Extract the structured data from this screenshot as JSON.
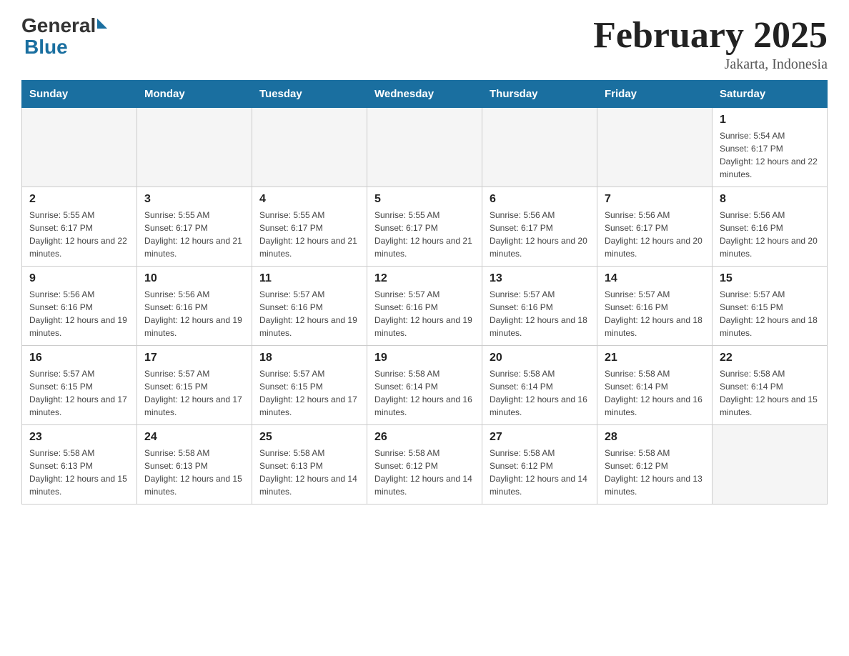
{
  "header": {
    "logo_general": "General",
    "logo_blue": "Blue",
    "month_title": "February 2025",
    "location": "Jakarta, Indonesia"
  },
  "days_of_week": [
    "Sunday",
    "Monday",
    "Tuesday",
    "Wednesday",
    "Thursday",
    "Friday",
    "Saturday"
  ],
  "weeks": [
    [
      {
        "day": "",
        "info": ""
      },
      {
        "day": "",
        "info": ""
      },
      {
        "day": "",
        "info": ""
      },
      {
        "day": "",
        "info": ""
      },
      {
        "day": "",
        "info": ""
      },
      {
        "day": "",
        "info": ""
      },
      {
        "day": "1",
        "info": "Sunrise: 5:54 AM\nSunset: 6:17 PM\nDaylight: 12 hours and 22 minutes."
      }
    ],
    [
      {
        "day": "2",
        "info": "Sunrise: 5:55 AM\nSunset: 6:17 PM\nDaylight: 12 hours and 22 minutes."
      },
      {
        "day": "3",
        "info": "Sunrise: 5:55 AM\nSunset: 6:17 PM\nDaylight: 12 hours and 21 minutes."
      },
      {
        "day": "4",
        "info": "Sunrise: 5:55 AM\nSunset: 6:17 PM\nDaylight: 12 hours and 21 minutes."
      },
      {
        "day": "5",
        "info": "Sunrise: 5:55 AM\nSunset: 6:17 PM\nDaylight: 12 hours and 21 minutes."
      },
      {
        "day": "6",
        "info": "Sunrise: 5:56 AM\nSunset: 6:17 PM\nDaylight: 12 hours and 20 minutes."
      },
      {
        "day": "7",
        "info": "Sunrise: 5:56 AM\nSunset: 6:17 PM\nDaylight: 12 hours and 20 minutes."
      },
      {
        "day": "8",
        "info": "Sunrise: 5:56 AM\nSunset: 6:16 PM\nDaylight: 12 hours and 20 minutes."
      }
    ],
    [
      {
        "day": "9",
        "info": "Sunrise: 5:56 AM\nSunset: 6:16 PM\nDaylight: 12 hours and 19 minutes."
      },
      {
        "day": "10",
        "info": "Sunrise: 5:56 AM\nSunset: 6:16 PM\nDaylight: 12 hours and 19 minutes."
      },
      {
        "day": "11",
        "info": "Sunrise: 5:57 AM\nSunset: 6:16 PM\nDaylight: 12 hours and 19 minutes."
      },
      {
        "day": "12",
        "info": "Sunrise: 5:57 AM\nSunset: 6:16 PM\nDaylight: 12 hours and 19 minutes."
      },
      {
        "day": "13",
        "info": "Sunrise: 5:57 AM\nSunset: 6:16 PM\nDaylight: 12 hours and 18 minutes."
      },
      {
        "day": "14",
        "info": "Sunrise: 5:57 AM\nSunset: 6:16 PM\nDaylight: 12 hours and 18 minutes."
      },
      {
        "day": "15",
        "info": "Sunrise: 5:57 AM\nSunset: 6:15 PM\nDaylight: 12 hours and 18 minutes."
      }
    ],
    [
      {
        "day": "16",
        "info": "Sunrise: 5:57 AM\nSunset: 6:15 PM\nDaylight: 12 hours and 17 minutes."
      },
      {
        "day": "17",
        "info": "Sunrise: 5:57 AM\nSunset: 6:15 PM\nDaylight: 12 hours and 17 minutes."
      },
      {
        "day": "18",
        "info": "Sunrise: 5:57 AM\nSunset: 6:15 PM\nDaylight: 12 hours and 17 minutes."
      },
      {
        "day": "19",
        "info": "Sunrise: 5:58 AM\nSunset: 6:14 PM\nDaylight: 12 hours and 16 minutes."
      },
      {
        "day": "20",
        "info": "Sunrise: 5:58 AM\nSunset: 6:14 PM\nDaylight: 12 hours and 16 minutes."
      },
      {
        "day": "21",
        "info": "Sunrise: 5:58 AM\nSunset: 6:14 PM\nDaylight: 12 hours and 16 minutes."
      },
      {
        "day": "22",
        "info": "Sunrise: 5:58 AM\nSunset: 6:14 PM\nDaylight: 12 hours and 15 minutes."
      }
    ],
    [
      {
        "day": "23",
        "info": "Sunrise: 5:58 AM\nSunset: 6:13 PM\nDaylight: 12 hours and 15 minutes."
      },
      {
        "day": "24",
        "info": "Sunrise: 5:58 AM\nSunset: 6:13 PM\nDaylight: 12 hours and 15 minutes."
      },
      {
        "day": "25",
        "info": "Sunrise: 5:58 AM\nSunset: 6:13 PM\nDaylight: 12 hours and 14 minutes."
      },
      {
        "day": "26",
        "info": "Sunrise: 5:58 AM\nSunset: 6:12 PM\nDaylight: 12 hours and 14 minutes."
      },
      {
        "day": "27",
        "info": "Sunrise: 5:58 AM\nSunset: 6:12 PM\nDaylight: 12 hours and 14 minutes."
      },
      {
        "day": "28",
        "info": "Sunrise: 5:58 AM\nSunset: 6:12 PM\nDaylight: 12 hours and 13 minutes."
      },
      {
        "day": "",
        "info": ""
      }
    ]
  ]
}
